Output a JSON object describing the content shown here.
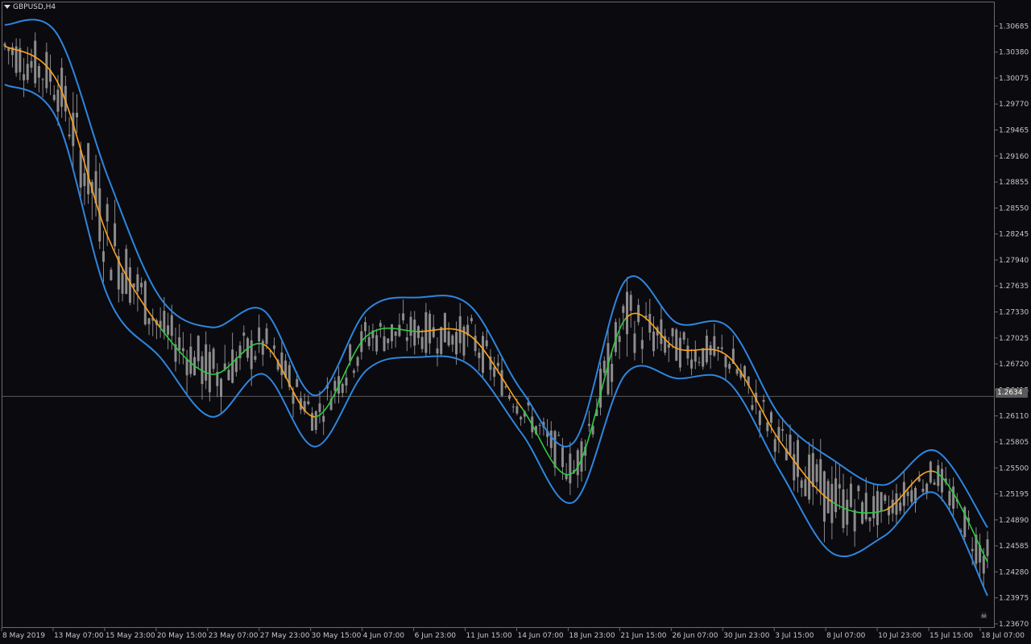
{
  "window": {
    "symbol_title": "GBPUSD,H4"
  },
  "price_axis": {
    "ticks": [
      "1.30685",
      "1.30380",
      "1.30075",
      "1.29770",
      "1.29465",
      "1.29160",
      "1.28855",
      "1.28550",
      "1.28245",
      "1.27940",
      "1.27635",
      "1.27330",
      "1.27025",
      "1.26720",
      "1.26415",
      "1.26110",
      "1.25805",
      "1.25500",
      "1.25195",
      "1.24890",
      "1.24585",
      "1.24280",
      "1.23975",
      "1.23670"
    ],
    "current_price_label": "1.26340"
  },
  "time_axis": {
    "ticks": [
      "8 May 2019",
      "13 May 07:00",
      "15 May 23:00",
      "20 May 15:00",
      "23 May 07:00",
      "27 May 23:00",
      "30 May 15:00",
      "4 Jun 07:00",
      "6 Jun 23:00",
      "11 Jun 15:00",
      "14 Jun 07:00",
      "18 Jun 23:00",
      "21 Jun 15:00",
      "26 Jun 07:00",
      "30 Jun 23:00",
      "3 Jul 15:00",
      "8 Jul 07:00",
      "10 Jul 23:00",
      "15 Jul 15:00",
      "18 Jul 07:00"
    ]
  },
  "colors": {
    "background": "#0a0a0f",
    "candle": "#8c8c8c",
    "upper_band": "#2e86de",
    "lower_band": "#2e86de",
    "middle_up": "#2ecc40",
    "middle_down": "#ffa31a",
    "grid_line": "#6b6b6b"
  },
  "chart_data": {
    "type": "line",
    "instrument": "GBPUSD",
    "timeframe": "H4",
    "ylim": [
      1.2367,
      1.3083
    ],
    "current_price": 1.2634,
    "middle_band": {
      "x": [
        "8 May 2019",
        "13 May 07:00",
        "15 May 23:00",
        "20 May 15:00",
        "23 May 07:00",
        "27 May 23:00",
        "30 May 15:00",
        "4 Jun 07:00",
        "6 Jun 23:00",
        "11 Jun 15:00",
        "14 Jun 07:00",
        "18 Jun 23:00",
        "21 Jun 15:00",
        "26 Jun 07:00",
        "30 Jun 23:00",
        "3 Jul 15:00",
        "8 Jul 07:00",
        "10 Jul 23:00",
        "15 Jul 15:00",
        "18 Jul 07:00"
      ],
      "values": [
        1.3045,
        1.3005,
        1.282,
        1.2715,
        1.266,
        1.2695,
        1.261,
        1.2705,
        1.271,
        1.2705,
        1.262,
        1.2545,
        1.2725,
        1.269,
        1.268,
        1.258,
        1.251,
        1.25,
        1.2545,
        1.244
      ],
      "color_state": [
        "down",
        "down",
        "down",
        "down",
        "up",
        "up",
        "down",
        "up",
        "up",
        "down",
        "down",
        "up",
        "up",
        "down",
        "down",
        "down",
        "down",
        "up",
        "down",
        "up"
      ]
    },
    "upper_band": {
      "values": [
        1.307,
        1.306,
        1.289,
        1.275,
        1.2715,
        1.2735,
        1.2635,
        1.2735,
        1.275,
        1.274,
        1.264,
        1.258,
        1.277,
        1.272,
        1.2715,
        1.261,
        1.256,
        1.253,
        1.257,
        1.248
      ]
    },
    "lower_band": {
      "values": [
        1.3,
        1.296,
        1.275,
        1.268,
        1.261,
        1.266,
        1.2575,
        1.2665,
        1.268,
        1.267,
        1.259,
        1.251,
        1.266,
        1.2655,
        1.265,
        1.2545,
        1.245,
        1.247,
        1.252,
        1.24
      ]
    }
  }
}
